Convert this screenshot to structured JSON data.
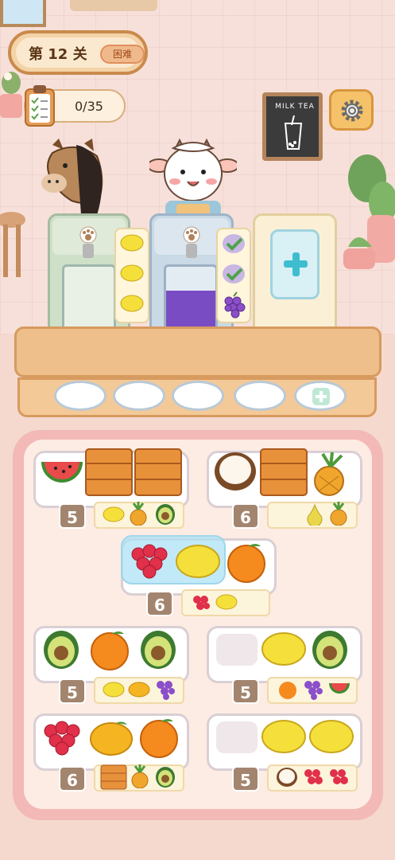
{
  "hud": {
    "level_label": "第 12 关",
    "difficulty_label": "困难",
    "progress_label": "0/35",
    "sign_text": "MILK TEA",
    "settings_icon": "gear-icon"
  },
  "counts": [
    "5",
    "6",
    "6",
    "5",
    "5",
    "6",
    "5"
  ],
  "colors": {
    "accent": "#c98a4c",
    "play_area": "#f3b9b6",
    "badge": "#a3856f"
  }
}
